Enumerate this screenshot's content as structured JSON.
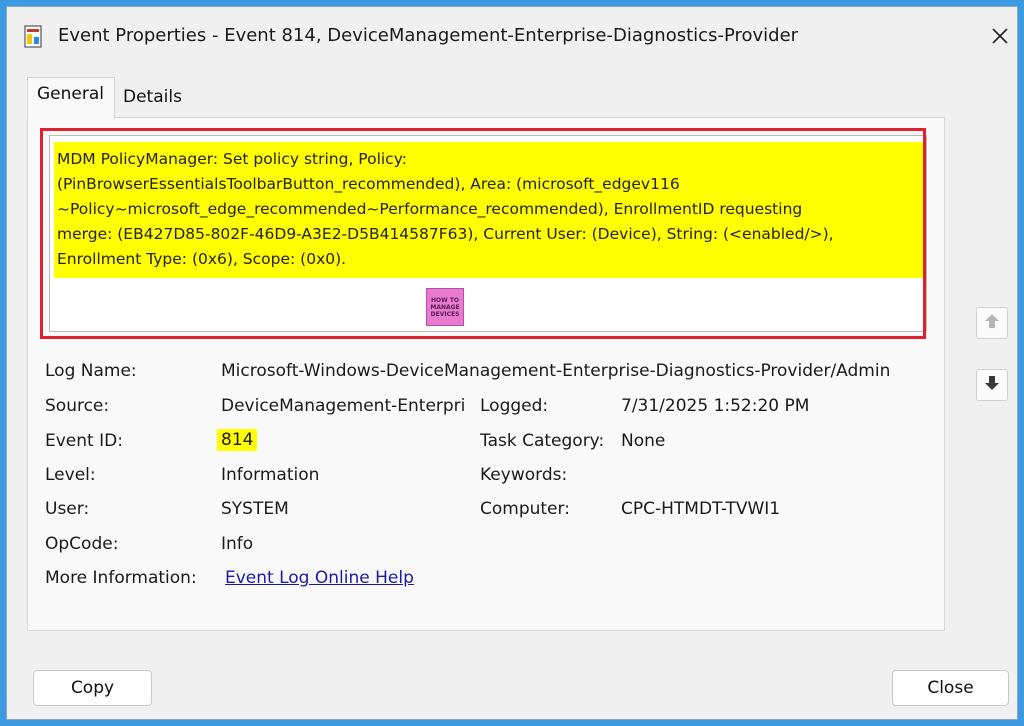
{
  "window": {
    "title": "Event Properties - Event 814, DeviceManagement-Enterprise-Diagnostics-Provider",
    "app_icon": "event-viewer-icon",
    "close_icon": "close-icon"
  },
  "tabs": [
    {
      "label": "General",
      "active": true
    },
    {
      "label": "Details",
      "active": false
    }
  ],
  "description": {
    "lines": [
      "MDM PolicyManager: Set policy string, Policy:",
      "(PinBrowserEssentialsToolbarButton_recommended), Area: (microsoft_edgev116",
      "~Policy~microsoft_edge_recommended~Performance_recommended), EnrollmentID requesting",
      "merge: (EB427D85-802F-46D9-A3E2-D5B414587F63), Current User: (Device), String: (<enabled/>),",
      "Enrollment Type: (0x6), Scope: (0x0)."
    ],
    "highlight_color": "#ffff00",
    "frame_color": "#e0202c",
    "watermark": {
      "line1": "HOW TO",
      "line2": "MANAGE",
      "line3": "DEVICES"
    }
  },
  "fields": {
    "log_name": {
      "label": "Log Name:",
      "value": "Microsoft-Windows-DeviceManagement-Enterprise-Diagnostics-Provider/Admin"
    },
    "source": {
      "label": "Source:",
      "value": "DeviceManagement-Enterprise-Diagnostics-Provider"
    },
    "logged": {
      "label": "Logged:",
      "value": "7/31/2025 1:52:20 PM"
    },
    "event_id": {
      "label": "Event ID:",
      "value": "814"
    },
    "task_category": {
      "label": "Task Category:",
      "value": "None"
    },
    "level": {
      "label": "Level:",
      "value": "Information"
    },
    "keywords": {
      "label": "Keywords:",
      "value": ""
    },
    "user": {
      "label": "User:",
      "value": "SYSTEM"
    },
    "computer": {
      "label": "Computer:",
      "value": "CPC-HTMDT-TVWI1"
    },
    "opcode": {
      "label": "OpCode:",
      "value": "Info"
    },
    "more_information": {
      "label": "More Information:",
      "link": "Event Log Online Help"
    }
  },
  "nav": {
    "up_icon": "arrow-up-icon",
    "down_icon": "arrow-down-icon"
  },
  "buttons": {
    "copy": "Copy",
    "close": "Close"
  }
}
